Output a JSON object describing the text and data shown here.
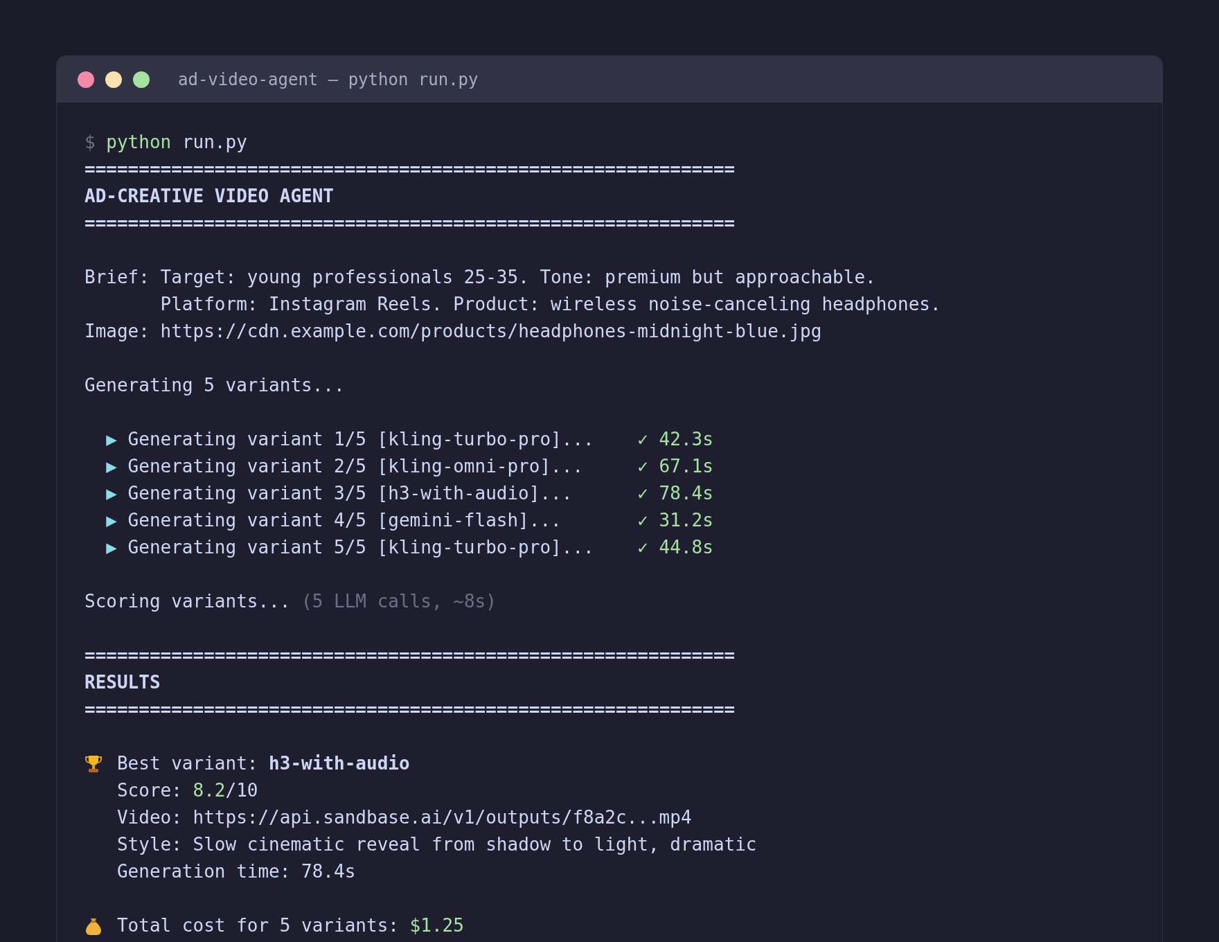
{
  "window": {
    "title": "ad-video-agent — python run.py",
    "dots": [
      {
        "color": "#f38ba8"
      },
      {
        "color": "#f9e2af"
      },
      {
        "color": "#a6e3a1"
      }
    ]
  },
  "prompt": {
    "symbol": "$",
    "command": "python",
    "args": "run.py"
  },
  "lines": [
    {
      "kind": "rule",
      "text": "============================================================"
    },
    {
      "kind": "heading",
      "text": "AD-CREATIVE VIDEO AGENT"
    },
    {
      "kind": "rule",
      "text": "============================================================"
    },
    {
      "kind": "blank"
    },
    {
      "kind": "text",
      "text": "Brief: Target: young professionals 25-35. Tone: premium but approachable."
    },
    {
      "kind": "indented",
      "text": "Platform: Instagram Reels. Product: wireless noise-canceling headphones."
    },
    {
      "kind": "text",
      "text": "Image: https://cdn.example.com/products/headphones-midnight-blue.jpg"
    },
    {
      "kind": "blank"
    },
    {
      "kind": "text",
      "text": "Generating 5 variants..."
    },
    {
      "kind": "blank"
    },
    {
      "kind": "variant",
      "marker": "▶",
      "label": "Generating variant 1/5 [kling-turbo-pro]...",
      "result": "✓ 42.3s"
    },
    {
      "kind": "variant",
      "marker": "▶",
      "label": "Generating variant 2/5 [kling-omni-pro]...",
      "result": "✓ 67.1s"
    },
    {
      "kind": "variant",
      "marker": "▶",
      "label": "Generating variant 3/5 [h3-with-audio]...",
      "result": "✓ 78.4s"
    },
    {
      "kind": "variant",
      "marker": "▶",
      "label": "Generating variant 4/5 [gemini-flash]...",
      "result": "✓ 31.2s"
    },
    {
      "kind": "variant",
      "marker": "▶",
      "label": "Generating variant 5/5 [kling-turbo-pro]...",
      "result": "✓ 44.8s"
    },
    {
      "kind": "blank"
    },
    {
      "kind": "note",
      "text": "Scoring variants...",
      "note": "(5 LLM calls, ~8s)"
    },
    {
      "kind": "blank"
    },
    {
      "kind": "rule",
      "text": "============================================================"
    },
    {
      "kind": "heading",
      "text": "RESULTS"
    },
    {
      "kind": "rule",
      "text": "============================================================"
    },
    {
      "kind": "blank"
    },
    {
      "kind": "best",
      "label": "Best variant:",
      "value": "h3-with-audio"
    },
    {
      "kind": "score",
      "label": "Score:",
      "value": "8.2",
      "suffix": "/10"
    },
    {
      "kind": "detail",
      "text": "Video: https://api.sandbase.ai/v1/outputs/f8a2c...mp4"
    },
    {
      "kind": "detail",
      "text": "Style: Slow cinematic reveal from shadow to light, dramatic"
    },
    {
      "kind": "detail",
      "text": "Generation time: 78.4s"
    },
    {
      "kind": "blank"
    },
    {
      "kind": "cost",
      "label": "Total cost for 5 variants:",
      "value": "$1.25"
    }
  ]
}
